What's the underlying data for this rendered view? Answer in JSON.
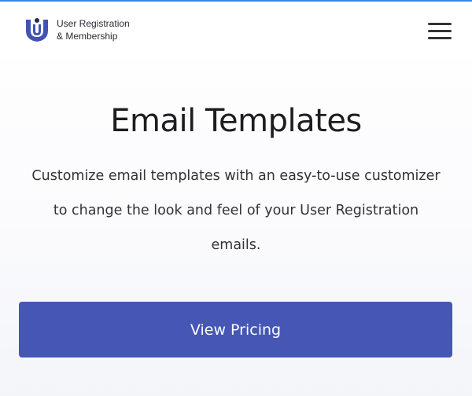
{
  "header": {
    "logo_line1": "User Registration",
    "logo_line2": "& Membership",
    "logo_icon": "ur-logo-icon",
    "menu_icon": "hamburger-menu-icon"
  },
  "main": {
    "title": "Email Templates",
    "description": "Customize email templates with an easy-to-use customizer to change the look and feel of your User Registration emails.",
    "cta_label": "View Pricing"
  },
  "colors": {
    "accent": "#4556b4",
    "top_border": "#3a86e0",
    "logo_blue": "#4353b3",
    "logo_dark": "#2a2a4a"
  }
}
